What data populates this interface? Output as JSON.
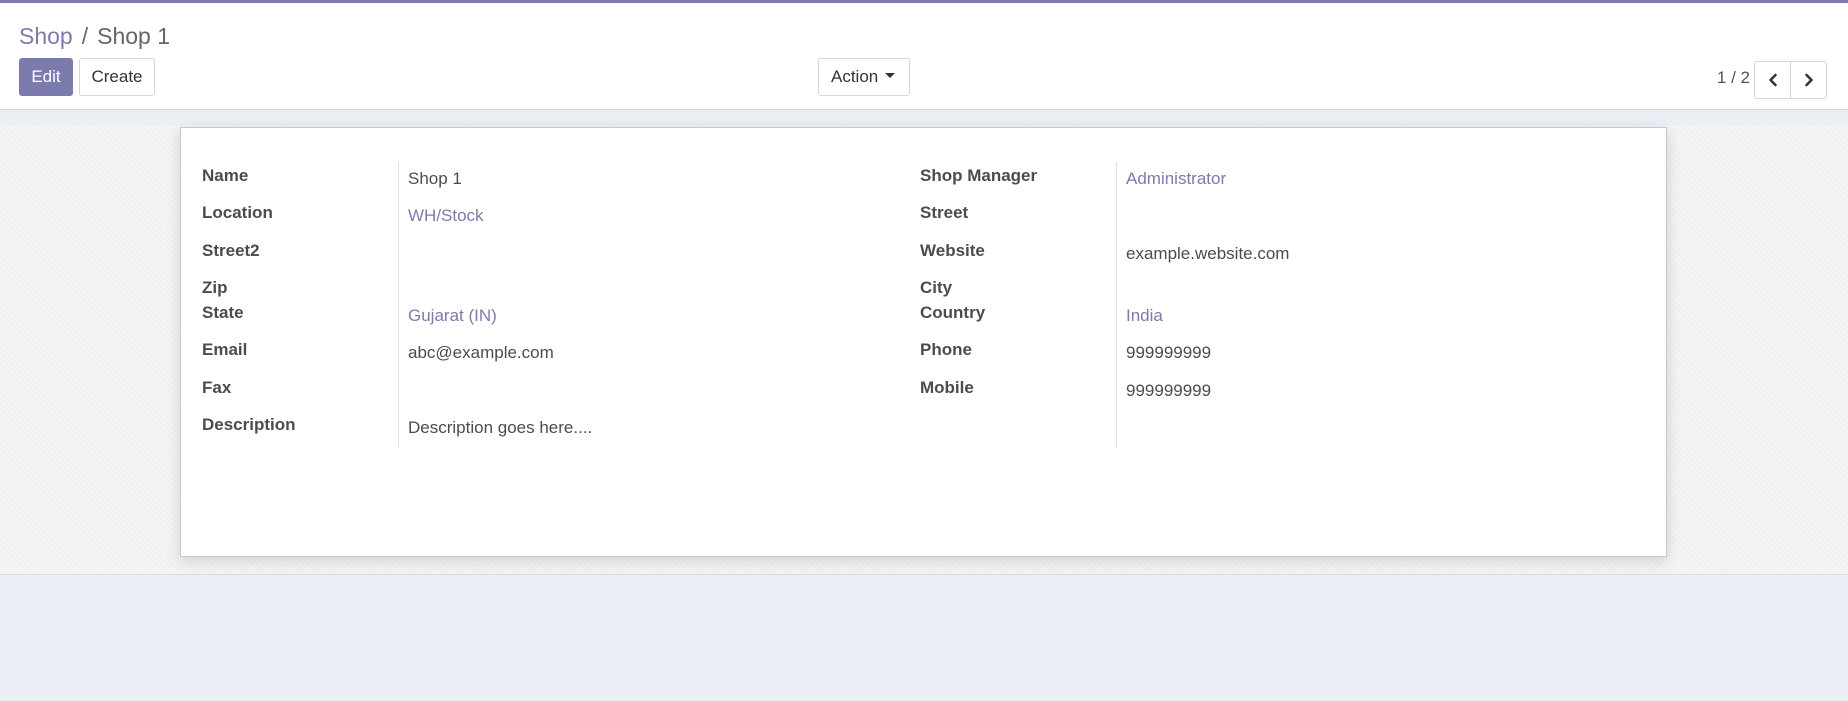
{
  "breadcrumb": {
    "parent": "Shop",
    "separator": "/",
    "current": "Shop 1"
  },
  "toolbar": {
    "edit_label": "Edit",
    "create_label": "Create",
    "action_label": "Action"
  },
  "pager": {
    "value": "1 / 2",
    "prev_icon": "chevron-left-icon",
    "next_icon": "chevron-right-icon"
  },
  "colors": {
    "primary": "#7c7bad",
    "link": "#7c7bad",
    "text": "#4c4c4c",
    "background": "#eceef5"
  },
  "form": {
    "name": {
      "label": "Name",
      "value": "Shop 1"
    },
    "location": {
      "label": "Location",
      "value": "WH/Stock"
    },
    "street2": {
      "label": "Street2",
      "value": ""
    },
    "zip": {
      "label": "Zip",
      "value": ""
    },
    "state": {
      "label": "State",
      "value": "Gujarat (IN)"
    },
    "email": {
      "label": "Email",
      "value": "abc@example.com"
    },
    "fax": {
      "label": "Fax",
      "value": ""
    },
    "description": {
      "label": "Description",
      "value": "Description goes here...."
    },
    "shop_manager": {
      "label": "Shop Manager",
      "value": "Administrator"
    },
    "street": {
      "label": "Street",
      "value": ""
    },
    "website": {
      "label": "Website",
      "value": "example.website.com"
    },
    "city": {
      "label": "City",
      "value": ""
    },
    "country": {
      "label": "Country",
      "value": "India"
    },
    "phone": {
      "label": "Phone",
      "value": "999999999"
    },
    "mobile": {
      "label": "Mobile",
      "value": "999999999"
    }
  }
}
